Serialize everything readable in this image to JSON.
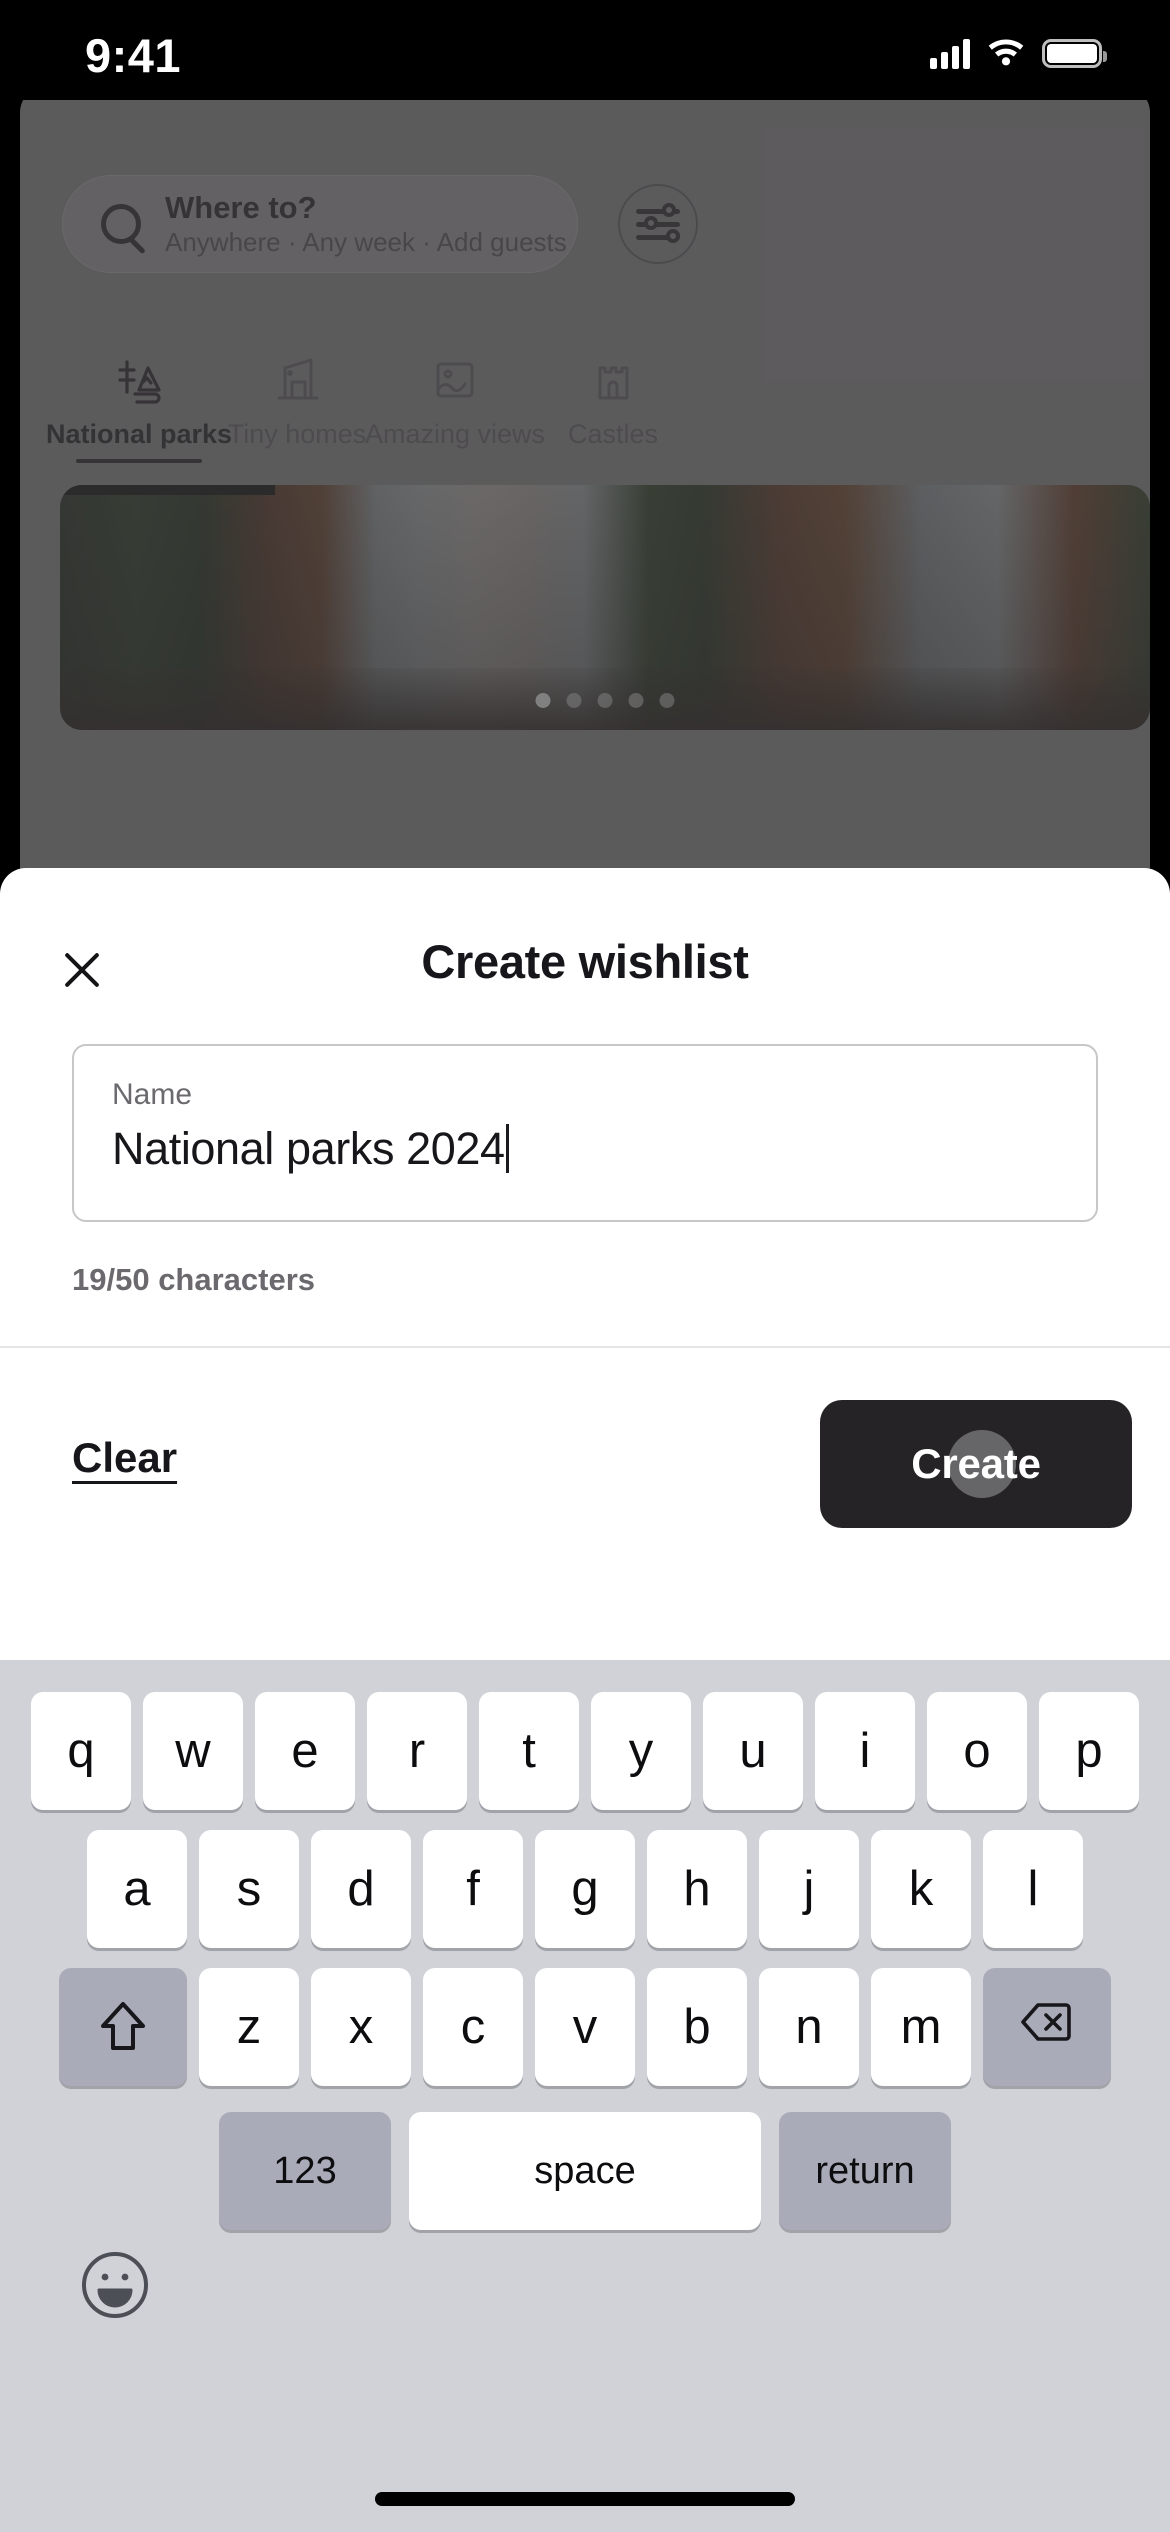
{
  "status_bar": {
    "time": "9:41",
    "signal_icon": "cellular-signal-icon",
    "wifi_icon": "wifi-icon",
    "battery_icon": "battery-icon"
  },
  "background_app": {
    "search": {
      "title": "Where to?",
      "subtitle": "Anywhere · Any week · Add guests",
      "search_icon": "search-icon",
      "filter_icon": "filter-sliders-icon"
    },
    "categories": [
      {
        "label": "National parks",
        "icon": "national-parks-icon",
        "active": true
      },
      {
        "label": "Tiny homes",
        "icon": "tiny-homes-icon",
        "active": false
      },
      {
        "label": "Amazing views",
        "icon": "amazing-views-icon",
        "active": false
      },
      {
        "label": "Castles",
        "icon": "castles-icon",
        "active": false
      }
    ],
    "listing_photo": {
      "alt": "listing-photo-garden-doors",
      "carousel_dots": 5,
      "active_dot": 1
    }
  },
  "modal": {
    "title": "Create wishlist",
    "close_icon": "close-icon",
    "name_field": {
      "label": "Name",
      "value": "National parks 2024",
      "placeholder": "Name"
    },
    "char_count": "19/50 characters",
    "clear_label": "Clear",
    "create_label": "Create"
  },
  "keyboard": {
    "row1": [
      "q",
      "w",
      "e",
      "r",
      "t",
      "y",
      "u",
      "i",
      "o",
      "p"
    ],
    "row2": [
      "a",
      "s",
      "d",
      "f",
      "g",
      "h",
      "j",
      "k",
      "l"
    ],
    "row3": [
      "z",
      "x",
      "c",
      "v",
      "b",
      "n",
      "m"
    ],
    "shift_icon": "shift-icon",
    "backspace_icon": "backspace-icon",
    "numbers_label": "123",
    "space_label": "space",
    "return_label": "return",
    "emoji_icon": "emoji-icon"
  },
  "home_indicator": "home-indicator"
}
